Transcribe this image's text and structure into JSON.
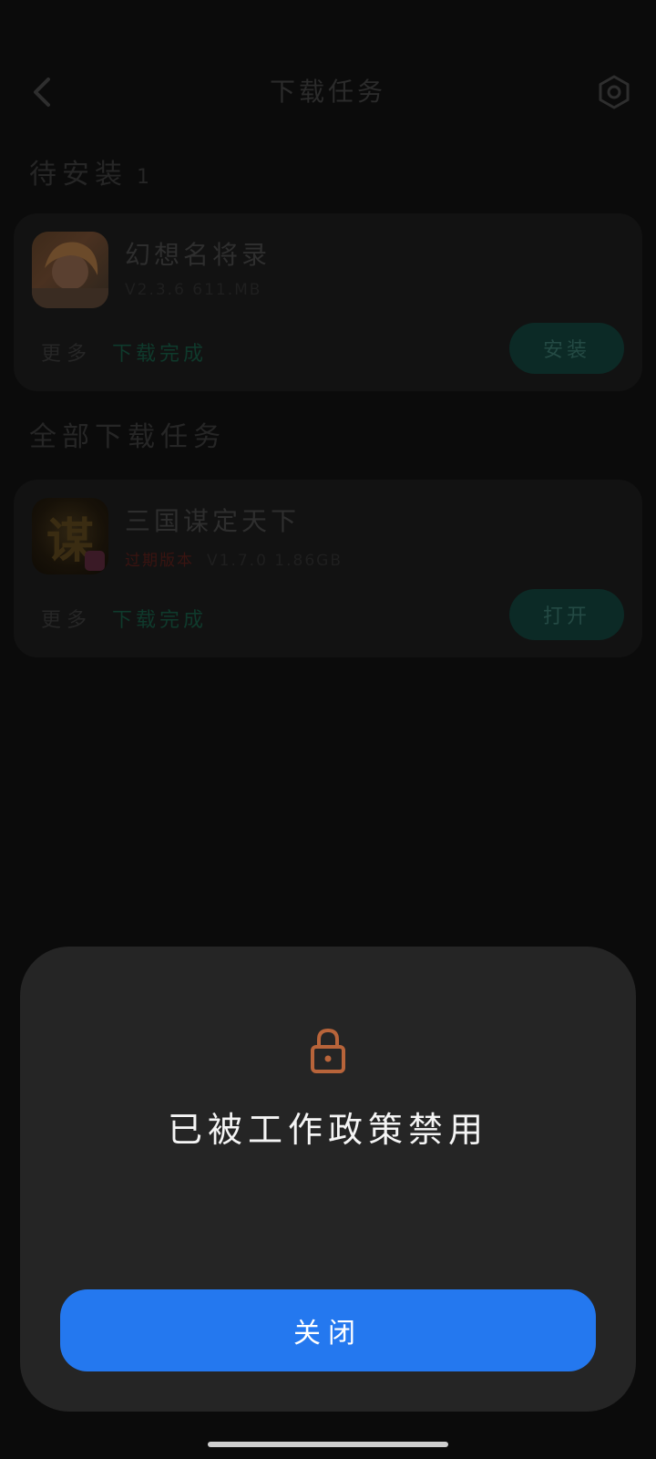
{
  "header": {
    "title": "下载任务",
    "back_icon": "chevron-left-icon",
    "settings_icon": "hexagon-settings-icon"
  },
  "sections": {
    "pending": {
      "title": "待安装",
      "count": "1"
    },
    "all": {
      "title": "全部下载任务"
    }
  },
  "tasks": [
    {
      "name": "幻想名将录",
      "meta": "V2.3.6  611.MB",
      "more_label": "更多",
      "status": "下载完成",
      "action_label": "安装"
    },
    {
      "name": "三国谋定天下",
      "outdated_label": "过期版本",
      "meta": "V1.7.0  1.86GB",
      "more_label": "更多",
      "status": "下载完成",
      "action_label": "打开",
      "icon_glyph": "谋"
    }
  ],
  "dialog": {
    "icon": "lock-icon",
    "message": "已被工作政策禁用",
    "close_label": "关闭"
  },
  "colors": {
    "accent_blue": "#2478ef",
    "lock_orange": "#b8643a",
    "dialog_bg": "#252525"
  }
}
